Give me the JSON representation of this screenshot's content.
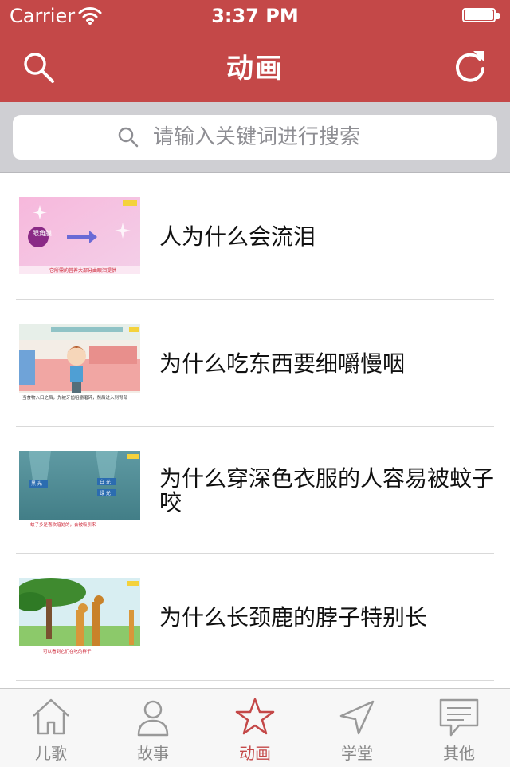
{
  "status_bar": {
    "carrier": "Carrier",
    "time": "3:37 PM"
  },
  "nav": {
    "title": "动画"
  },
  "search": {
    "placeholder": "请输入关键词进行搜索",
    "value": ""
  },
  "list": [
    {
      "title": "人为什么会流泪",
      "thumb_caption": "它所需的营养大部分由眼泪提供",
      "thumb_label": "眼角膜"
    },
    {
      "title": "为什么吃东西要细嚼慢咽",
      "thumb_caption": "当食物入口之后，先被牙齿咀嚼磨碎，然后进入到胃部"
    },
    {
      "title": "为什么穿深色衣服的人容易被蚊子咬",
      "thumb_caption": "蚊子多是喜欢暗处的，会被吸引来",
      "thumb_labels": [
        "黑 光",
        "白 光",
        "绿 光"
      ]
    },
    {
      "title": "为什么长颈鹿的脖子特别长",
      "thumb_caption": "可以看到它们在吃的样子"
    }
  ],
  "tabs": [
    {
      "label": "儿歌",
      "icon": "home-icon",
      "active": false
    },
    {
      "label": "故事",
      "icon": "person-icon",
      "active": false
    },
    {
      "label": "动画",
      "icon": "star-icon",
      "active": true
    },
    {
      "label": "学堂",
      "icon": "navigation-icon",
      "active": false
    },
    {
      "label": "其他",
      "icon": "message-icon",
      "active": false
    }
  ],
  "colors": {
    "accent": "#c44848",
    "tab_inactive": "#888888",
    "search_bg": "#cfcfd3"
  }
}
